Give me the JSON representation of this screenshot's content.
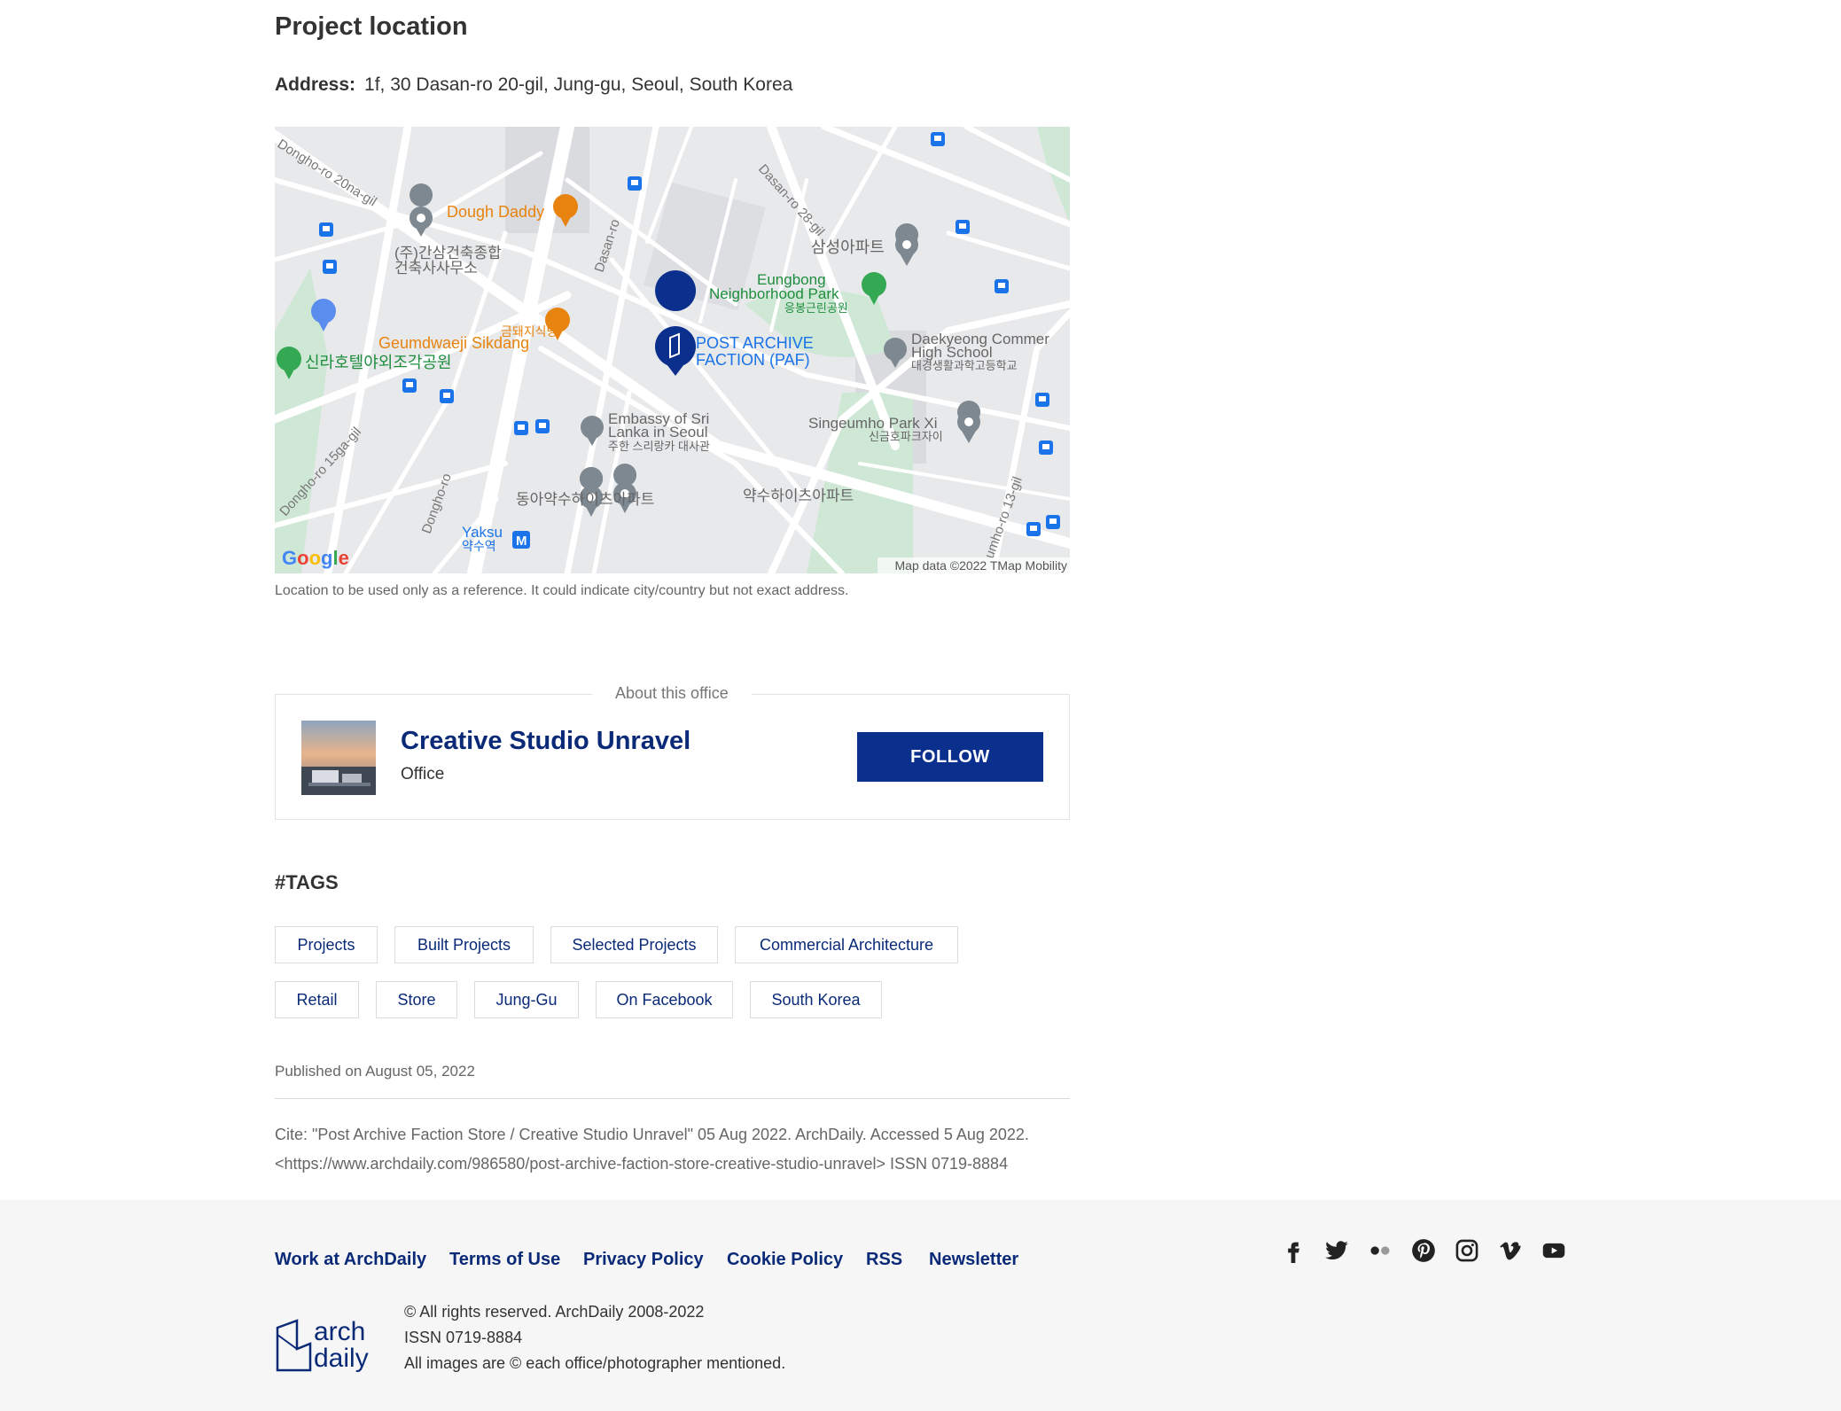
{
  "location": {
    "title": "Project location",
    "address_label": "Address:",
    "address_value": "1f, 30 Dasan-ro 20-gil, Jung-gu, Seoul, South Korea",
    "map_note": "Location to be used only as a reference. It could indicate city/country but not exact address."
  },
  "map": {
    "pin_label": "POST ARCHIVE FACTION (PAF)",
    "places": {
      "dough_daddy": "Dough Daddy",
      "ganseom": "(주)간삼건축종합 건축사사무소",
      "geumdwaeji": "Geumdwaeji Sikdang",
      "geumdwaeji_ko": "금돼지식당",
      "shilla": "신라호텔야외조각공원",
      "samsung_apt": "삼성아파트",
      "eungbong": "Eungbong Neighborhood Park",
      "eungbong_ko": "응봉근린공원",
      "daekyeong": "Daekyeong Commer High School",
      "daekyeong_ko": "대경생활과학고등학교",
      "singeumho": "Singeumho Park Xi",
      "singeumho_ko": "신금호파크자이",
      "embassy": "Embassy of Sri Lanka in Seoul",
      "embassy_ko": "주한 스리랑카 대사관",
      "dong_a_apt": "동아약수하이츠아파트",
      "yaksu_apt": "약수하이츠아파트",
      "yaksu": "Yaksu",
      "yaksu_ko": "약수역"
    },
    "streets": {
      "dongho_20na": "Dongho-ro 20na-gil",
      "dasan_ro": "Dasan-ro",
      "dasan_28": "Dasan-ro 28-gil",
      "dongho_15ga": "Dongho-ro 15ga-gil",
      "dongho_ro": "Dongho-ro",
      "umho_13": "umho-ro 13-gil"
    },
    "google": "Google",
    "attribution": "Map data ©2022 TMap Mobility"
  },
  "office": {
    "legend": "About this office",
    "name": "Creative Studio Unravel",
    "type": "Office",
    "follow": "FOLLOW"
  },
  "tags": {
    "title": "#TAGS",
    "items": [
      "Projects",
      "Built Projects",
      "Selected Projects",
      "Commercial Architecture",
      "Retail",
      "Store",
      "Jung-Gu",
      "On Facebook",
      "South Korea"
    ]
  },
  "published": "Published on August 05, 2022",
  "cite": {
    "line1": "Cite: \"Post Archive Faction Store / Creative Studio Unravel\" 05 Aug 2022. ArchDaily. Accessed 5 Aug 2022.",
    "line2": "<https://www.archdaily.com/986580/post-archive-faction-store-creative-studio-unravel> ISSN 0719-8884"
  },
  "footer": {
    "links": [
      "Work at ArchDaily",
      "Terms of Use",
      "Privacy Policy",
      "Cookie Policy",
      "RSS",
      "Newsletter"
    ],
    "social_icons": [
      "facebook-icon",
      "twitter-icon",
      "flickr-icon",
      "pinterest-icon",
      "instagram-icon",
      "vimeo-icon",
      "youtube-icon"
    ],
    "logo_line1": "arch",
    "logo_line2": "daily",
    "copyright": "© All rights reserved. ArchDaily 2008-2022",
    "issn": "ISSN 0719-8884",
    "images_note": "All images are © each office/photographer mentioned."
  },
  "colors": {
    "brand": "#0a2f8c",
    "link": "#0a2a78",
    "map_orange": "#e8830f",
    "map_green": "#34a853",
    "map_blue": "#1a73e8"
  }
}
